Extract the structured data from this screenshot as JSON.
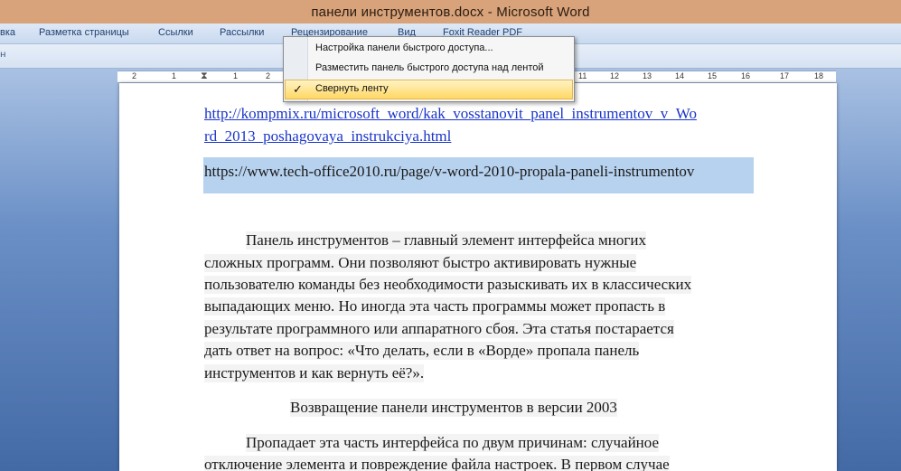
{
  "window": {
    "title": "панели инструментов.docx - Microsoft Word"
  },
  "ribbon": {
    "tabs": [
      {
        "label": "вка"
      },
      {
        "label": "Разметка страницы"
      },
      {
        "label": "Ссылки"
      },
      {
        "label": "Рассылки"
      },
      {
        "label": "Рецензирование"
      },
      {
        "label": "Вид"
      },
      {
        "label": "Foxit Reader PDF"
      }
    ],
    "sub_mark": "н"
  },
  "ruler": {
    "numbers": [
      "2",
      "1",
      "1",
      "2",
      "11",
      "12",
      "13",
      "14",
      "15",
      "16",
      "17",
      "18"
    ]
  },
  "quick_access_menu": {
    "items": [
      {
        "label": "Настройка панели быстрого доступа..."
      },
      {
        "label": "Разместить панель быстрого доступа над лентой"
      },
      {
        "label": "Свернуть ленту",
        "checked": true
      }
    ],
    "check_glyph": "✓"
  },
  "document": {
    "link_line1": "http://kompmix.ru/microsoft_word/kak_vosstanovit_panel_instrumentov_v_Wo",
    "link_line2": "rd_2013_poshagovaya_instrukciya.html",
    "selected_url": "https://www.tech-office2010.ru/page/v-word-2010-propala-paneli-instrumentov",
    "paragraph1": [
      "Панель инструментов – главный элемент  интерфейса  многих",
      "сложных программ. Они позволяют быстро активировать нужные",
      "пользователю команды без необходимости разыскивать их в классических",
      "выпадающих меню. Но иногда эта часть программы может пропасть в",
      "результате программного или аппаратного сбоя. Эта статья постарается",
      "дать ответ на вопрос: «Что делать, если в «Ворде» пропала панель",
      "инструментов и как вернуть её?»."
    ],
    "heading": "Возвращение панели инструментов в версии 2003",
    "paragraph2": [
      "Пропадает эта часть интерфейса по двум причинам: случайное",
      "отключение элемента и повреждение файла настроек. В первом случае"
    ]
  }
}
